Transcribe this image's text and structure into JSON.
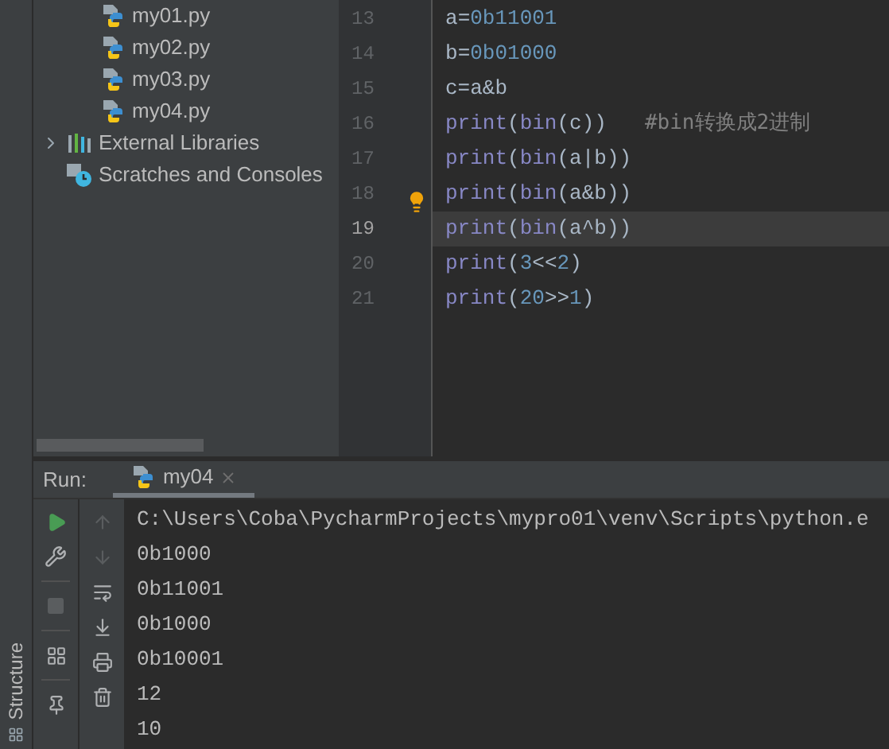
{
  "project_tree": {
    "items": [
      {
        "label": "my01.py",
        "kind": "python-file"
      },
      {
        "label": "my02.py",
        "kind": "python-file"
      },
      {
        "label": "my03.py",
        "kind": "python-file"
      },
      {
        "label": "my04.py",
        "kind": "python-file"
      },
      {
        "label": "External Libraries",
        "kind": "library"
      },
      {
        "label": "Scratches and Consoles",
        "kind": "scratches"
      }
    ]
  },
  "editor": {
    "lines": [
      {
        "number": "13",
        "current": false,
        "tokens": [
          {
            "text": "a",
            "kind": "name"
          },
          {
            "text": "=",
            "kind": "op"
          },
          {
            "text": "0b11001",
            "kind": "number"
          }
        ]
      },
      {
        "number": "14",
        "current": false,
        "tokens": [
          {
            "text": "b",
            "kind": "name"
          },
          {
            "text": "=",
            "kind": "op"
          },
          {
            "text": "0b01000",
            "kind": "number"
          }
        ]
      },
      {
        "number": "15",
        "current": false,
        "tokens": [
          {
            "text": "c=a&b",
            "kind": "name"
          }
        ]
      },
      {
        "number": "16",
        "current": false,
        "tokens": [
          {
            "text": "print",
            "kind": "builtin"
          },
          {
            "text": "(",
            "kind": "op"
          },
          {
            "text": "bin",
            "kind": "builtin"
          },
          {
            "text": "(c))",
            "kind": "name"
          },
          {
            "text": "#bin转换成2进制",
            "kind": "comment"
          }
        ]
      },
      {
        "number": "17",
        "current": false,
        "tokens": [
          {
            "text": "print",
            "kind": "builtin"
          },
          {
            "text": "(",
            "kind": "op"
          },
          {
            "text": "bin",
            "kind": "builtin"
          },
          {
            "text": "(a|b))",
            "kind": "name"
          }
        ]
      },
      {
        "number": "18",
        "current": false,
        "tokens": [
          {
            "text": "print",
            "kind": "builtin"
          },
          {
            "text": "(",
            "kind": "op"
          },
          {
            "text": "bin",
            "kind": "builtin"
          },
          {
            "text": "(a&b))",
            "kind": "name"
          }
        ]
      },
      {
        "number": "19",
        "current": true,
        "tokens": [
          {
            "text": "print",
            "kind": "builtin"
          },
          {
            "text": "(",
            "kind": "op"
          },
          {
            "text": "bin",
            "kind": "builtin"
          },
          {
            "text": "(a^b))",
            "kind": "name"
          }
        ]
      },
      {
        "number": "20",
        "current": false,
        "tokens": [
          {
            "text": "print",
            "kind": "builtin"
          },
          {
            "text": "(",
            "kind": "op"
          },
          {
            "text": "3",
            "kind": "number"
          },
          {
            "text": "<<",
            "kind": "op"
          },
          {
            "text": "2",
            "kind": "number"
          },
          {
            "text": ")",
            "kind": "op"
          }
        ]
      },
      {
        "number": "21",
        "current": false,
        "tokens": [
          {
            "text": "print",
            "kind": "builtin"
          },
          {
            "text": "(",
            "kind": "op"
          },
          {
            "text": "20",
            "kind": "number"
          },
          {
            "text": ">>",
            "kind": "op"
          },
          {
            "text": "1",
            "kind": "number"
          },
          {
            "text": ")",
            "kind": "op"
          }
        ]
      }
    ]
  },
  "run_panel": {
    "label": "Run:",
    "tabs": [
      {
        "label": "my04",
        "selected": true
      }
    ],
    "output": [
      "C:\\Users\\Coba\\PycharmProjects\\mypro01\\venv\\Scripts\\python.e",
      "0b1000",
      "0b11001",
      "0b1000",
      "0b10001",
      "12",
      "10"
    ]
  },
  "side_stripe": {
    "label": "Structure"
  }
}
